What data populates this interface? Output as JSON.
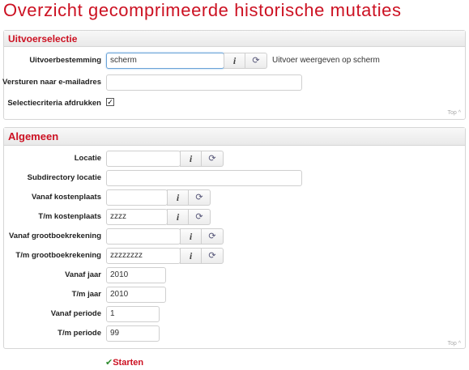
{
  "page": {
    "title": "Overzicht gecomprimeerde historische mutaties"
  },
  "uitvoer": {
    "header": "Uitvoerselectie",
    "bestemming_label": "Uitvoerbestemming",
    "bestemming_value": "scherm",
    "bestemming_hint": "Uitvoer weergeven op scherm",
    "email_label": "Versturen naar e-mailadres",
    "email_value": "",
    "afdrukken_label": "Selectiecriteria afdrukken",
    "afdrukken_checked": true,
    "top_link": "Top"
  },
  "algemeen": {
    "header": "Algemeen",
    "locatie_label": "Locatie",
    "locatie_value": "",
    "subdir_label": "Subdirectory locatie",
    "subdir_value": "",
    "vanaf_kp_label": "Vanaf kostenplaats",
    "vanaf_kp_value": "",
    "tm_kp_label": "T/m kostenplaats",
    "tm_kp_value": "zzzz",
    "vanaf_gb_label": "Vanaf grootboekrekening",
    "vanaf_gb_value": "",
    "tm_gb_label": "T/m grootboekrekening",
    "tm_gb_value": "zzzzzzzz",
    "vanaf_jaar_label": "Vanaf jaar",
    "vanaf_jaar_value": "2010",
    "tm_jaar_label": "T/m jaar",
    "tm_jaar_value": "2010",
    "vanaf_periode_label": "Vanaf periode",
    "vanaf_periode_value": "1",
    "tm_periode_label": "T/m periode",
    "tm_periode_value": "99",
    "top_link": "Top"
  },
  "actions": {
    "start_label": "Starten"
  },
  "icons": {
    "info": "info-icon",
    "refresh": "refresh-icon",
    "check": "checkmark-icon"
  }
}
